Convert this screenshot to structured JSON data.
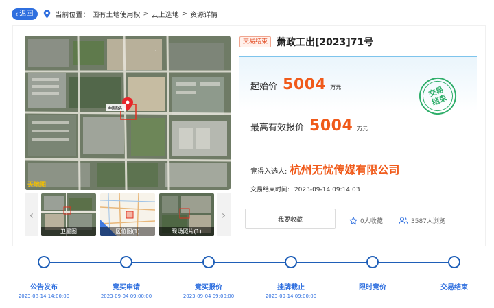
{
  "nav": {
    "back_label": "返回",
    "location_prefix": "当前位置：",
    "breadcrumb": [
      "国有土地使用权",
      "云上选地",
      "资源详情"
    ],
    "separator": ">"
  },
  "gallery": {
    "map_labels": [
      "明星路",
      "杭州无忧传媒有限公司",
      "天地图"
    ],
    "thumbnails": [
      {
        "caption": "卫星图",
        "selected": false
      },
      {
        "caption": "区位图(1)",
        "selected": true
      },
      {
        "caption": "现场照片(1)",
        "selected": false
      }
    ],
    "prev_icon": "chevron-left-icon",
    "next_icon": "chevron-right-icon"
  },
  "lot": {
    "status_tag": "交易结束",
    "title": "萧政工出[2023]71号",
    "starting_price_label": "起始价",
    "starting_price": "5004",
    "starting_price_unit": "万元",
    "highest_bid_label": "最高有效报价",
    "highest_bid": "5004",
    "highest_bid_unit": "万元",
    "stamp_line1": "交易",
    "stamp_line2": "结束",
    "winner_label": "竞得入选人:",
    "winner_name": "杭州无忧传媒有限公司",
    "end_time_label": "交易结束时间:",
    "end_time": "2023-09-14 09:14:03",
    "favorite_label": "我要收藏",
    "favorites": "0人收藏",
    "views": "3587人浏览"
  },
  "colors": {
    "accent": "#2f6fdf",
    "price": "#f05a1a",
    "stamp": "#2fae6a",
    "timeline": "#1f5fb8"
  },
  "timeline": [
    {
      "label": "公告发布",
      "date": "2023-08-14 14:00:00"
    },
    {
      "label": "竞买申请",
      "date": "2023-09-04 09:00:00"
    },
    {
      "label": "竞买报价",
      "date": "2023-09-04 09:00:00"
    },
    {
      "label": "挂牌截止",
      "date": "2023-09-14 09:00:00"
    },
    {
      "label": "限时竞价",
      "date": ""
    },
    {
      "label": "交易结束",
      "date": ""
    }
  ]
}
